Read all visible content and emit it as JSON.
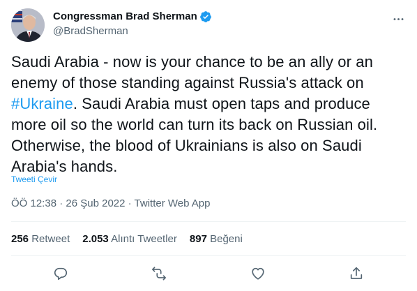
{
  "author": {
    "name": "Congressman Brad Sherman",
    "handle": "@BradSherman"
  },
  "tweet": {
    "text_part1": "Saudi Arabia - now is your chance to be an ally or an enemy of those standing against Russia's attack on ",
    "hashtag": "#Ukraine",
    "text_part2": ". Saudi Arabia must open taps and produce more oil so the world can turn its back on Russian oil. Otherwise, the blood of Ukrainians is also on Saudi Arabia's hands."
  },
  "translate_label": "Tweeti Çevir",
  "meta": {
    "time": "ÖÖ 12:38",
    "separator1": "·",
    "date": "26 Şub 2022",
    "separator2": "·",
    "source": "Twitter Web App"
  },
  "stats": {
    "retweets_count": "256",
    "retweets_label": "Retweet",
    "quotes_count": "2.053",
    "quotes_label": "Alıntı Tweetler",
    "likes_count": "897",
    "likes_label": "Beğeni"
  },
  "icons": {
    "verified": "verified-badge-icon",
    "more": "more-options-icon",
    "reply": "reply-icon",
    "retweet": "retweet-icon",
    "like": "like-icon",
    "share": "share-icon"
  },
  "colors": {
    "accent": "#1d9bf0",
    "text": "#0f1419",
    "secondary": "#536471",
    "divider": "#eff3f4"
  }
}
